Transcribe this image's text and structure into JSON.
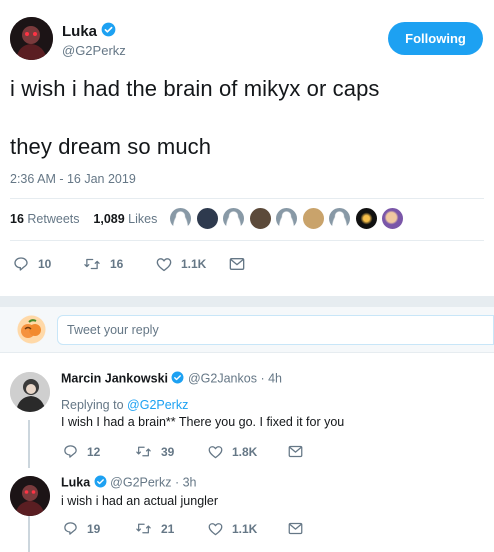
{
  "main_tweet": {
    "author_name": "Luka",
    "author_handle": "@G2Perkz",
    "follow_button": "Following",
    "text_line1": "i wish i had the brain of mikyx or caps",
    "text_line2": "they dream so much",
    "timestamp": "2:36 AM - 16 Jan 2019",
    "retweets_count": "16",
    "retweets_label": "Retweets",
    "likes_count": "1,089",
    "likes_label": "Likes",
    "actions": {
      "replies": "10",
      "retweets": "16",
      "likes": "1.1K"
    }
  },
  "reply_box": {
    "placeholder": "Tweet your reply"
  },
  "replies": [
    {
      "author_name": "Marcin Jankowski",
      "author_handle": "@G2Jankos",
      "time": "· 4h",
      "replying_prefix": "Replying to",
      "replying_handle": "@G2Perkz",
      "text": "I wish I had a brain** There you go. I fixed it for you",
      "actions": {
        "replies": "12",
        "retweets": "39",
        "likes": "1.8K"
      }
    },
    {
      "author_name": "Luka",
      "author_handle": "@G2Perkz",
      "time": "· 3h",
      "text": "i wish i had an actual jungler",
      "actions": {
        "replies": "19",
        "retweets": "21",
        "likes": "1.1K"
      }
    }
  ],
  "colors": {
    "accent": "#1da1f2",
    "muted": "#657786",
    "divider": "#e6ecf0"
  },
  "icons": [
    "verified-icon",
    "reply-icon",
    "retweet-icon",
    "like-icon",
    "message-icon"
  ]
}
